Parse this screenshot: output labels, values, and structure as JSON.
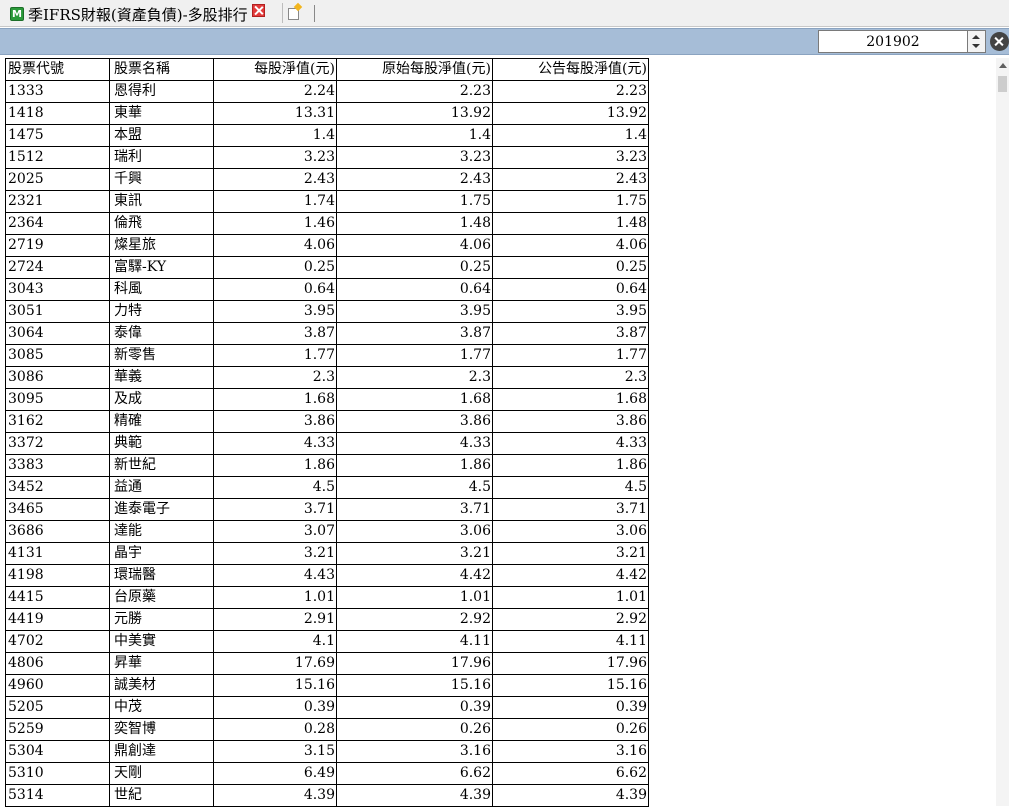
{
  "tab": {
    "icon_letter": "M",
    "title": "季IFRS財報(資產負債)-多股排行"
  },
  "toolbar": {
    "period_value": "201902"
  },
  "table": {
    "headers": [
      "股票代號",
      "股票名稱",
      "每股淨值(元)",
      "原始每股淨值(元)",
      "公告每股淨值(元)"
    ],
    "rows": [
      [
        "1333",
        "恩得利",
        "2.24",
        "2.23",
        "2.23"
      ],
      [
        "1418",
        "東華",
        "13.31",
        "13.92",
        "13.92"
      ],
      [
        "1475",
        "本盟",
        "1.4",
        "1.4",
        "1.4"
      ],
      [
        "1512",
        "瑞利",
        "3.23",
        "3.23",
        "3.23"
      ],
      [
        "2025",
        "千興",
        "2.43",
        "2.43",
        "2.43"
      ],
      [
        "2321",
        "東訊",
        "1.74",
        "1.75",
        "1.75"
      ],
      [
        "2364",
        "倫飛",
        "1.46",
        "1.48",
        "1.48"
      ],
      [
        "2719",
        "燦星旅",
        "4.06",
        "4.06",
        "4.06"
      ],
      [
        "2724",
        "富驛-KY",
        "0.25",
        "0.25",
        "0.25"
      ],
      [
        "3043",
        "科風",
        "0.64",
        "0.64",
        "0.64"
      ],
      [
        "3051",
        "力特",
        "3.95",
        "3.95",
        "3.95"
      ],
      [
        "3064",
        "泰偉",
        "3.87",
        "3.87",
        "3.87"
      ],
      [
        "3085",
        "新零售",
        "1.77",
        "1.77",
        "1.77"
      ],
      [
        "3086",
        "華義",
        "2.3",
        "2.3",
        "2.3"
      ],
      [
        "3095",
        "及成",
        "1.68",
        "1.68",
        "1.68"
      ],
      [
        "3162",
        "精確",
        "3.86",
        "3.86",
        "3.86"
      ],
      [
        "3372",
        "典範",
        "4.33",
        "4.33",
        "4.33"
      ],
      [
        "3383",
        "新世紀",
        "1.86",
        "1.86",
        "1.86"
      ],
      [
        "3452",
        "益通",
        "4.5",
        "4.5",
        "4.5"
      ],
      [
        "3465",
        "進泰電子",
        "3.71",
        "3.71",
        "3.71"
      ],
      [
        "3686",
        "達能",
        "3.07",
        "3.06",
        "3.06"
      ],
      [
        "4131",
        "晶宇",
        "3.21",
        "3.21",
        "3.21"
      ],
      [
        "4198",
        "環瑞醫",
        "4.43",
        "4.42",
        "4.42"
      ],
      [
        "4415",
        "台原藥",
        "1.01",
        "1.01",
        "1.01"
      ],
      [
        "4419",
        "元勝",
        "2.91",
        "2.92",
        "2.92"
      ],
      [
        "4702",
        "中美實",
        "4.1",
        "4.11",
        "4.11"
      ],
      [
        "4806",
        "昇華",
        "17.69",
        "17.96",
        "17.96"
      ],
      [
        "4960",
        "誠美材",
        "15.16",
        "15.16",
        "15.16"
      ],
      [
        "5205",
        "中茂",
        "0.39",
        "0.39",
        "0.39"
      ],
      [
        "5259",
        "奕智博",
        "0.28",
        "0.26",
        "0.26"
      ],
      [
        "5304",
        "鼎創達",
        "3.15",
        "3.16",
        "3.16"
      ],
      [
        "5310",
        "天剛",
        "6.49",
        "6.62",
        "6.62"
      ],
      [
        "5314",
        "世紀",
        "4.39",
        "4.39",
        "4.39"
      ]
    ]
  }
}
